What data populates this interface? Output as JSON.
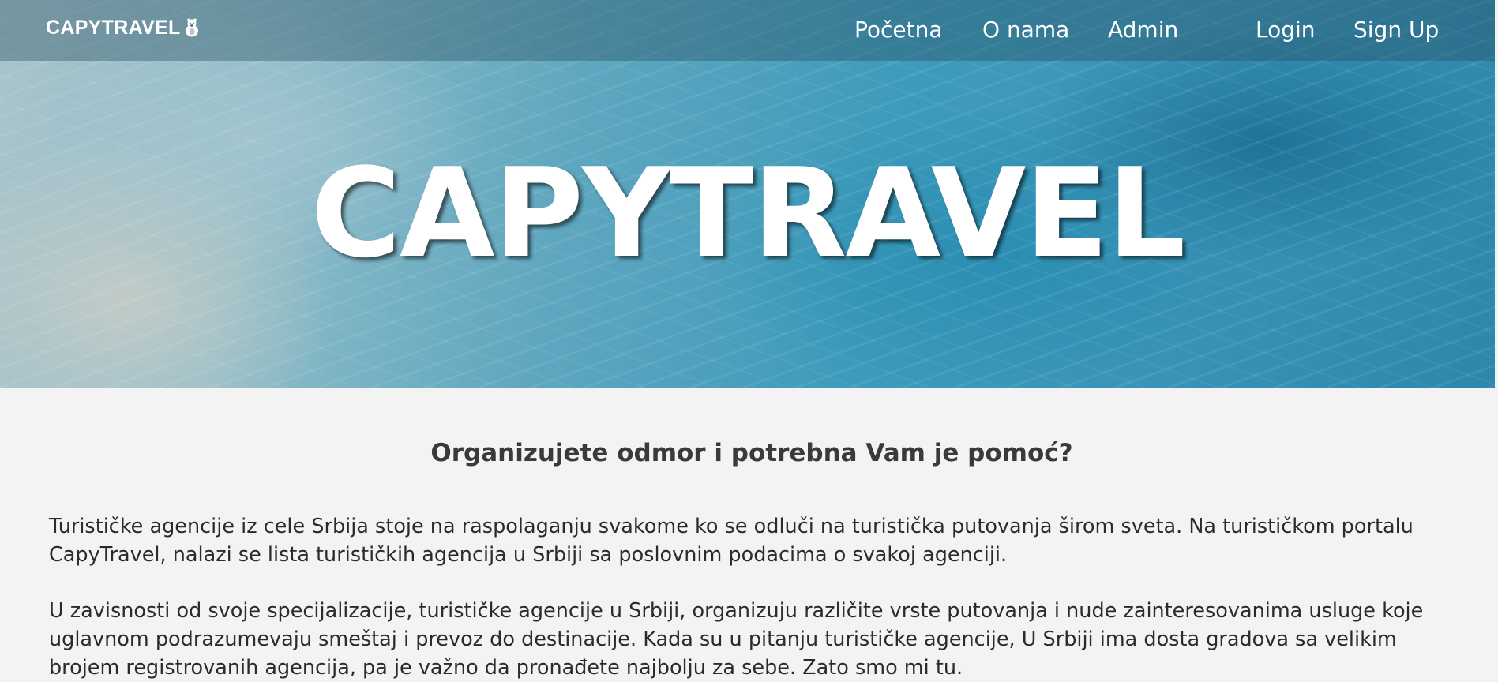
{
  "navbar": {
    "brand": "CAPYTRAVEL",
    "brand_icon": "capybara-icon",
    "links": {
      "home": "Početna",
      "about": "O nama",
      "admin": "Admin",
      "login": "Login",
      "signup": "Sign Up"
    }
  },
  "hero": {
    "title": "CAPYTRAVEL"
  },
  "main": {
    "heading": "Organizujete odmor i potrebna Vam je pomoć?",
    "paragraphs": [
      "Turističke agencije iz cele Srbija stoje na raspolaganju svakome ko se odluči na turistička putovanja širom sveta. Na turističkom portalu CapyTravel, nalazi se lista turističkih agencija u Srbiji sa poslovnim podacima o svakoj agenciji.",
      "U zavisnosti od svoje specijalizacije, turističke agencije u Srbiji, organizuju različite vrste putovanja i nude zainteresovanima usluge koje uglavnom podrazumevaju smeštaj i prevoz do destinacije. Kada su u pitanju turističke agencije, U Srbiji ima dosta gradova sa velikim brojem registrovanih agencija, pa je važno da pronađete najbolju za sebe. Zato smo mi tu."
    ]
  },
  "colors": {
    "page_background": "#f3f3f3",
    "hero_water": "#3f9bbb",
    "nav_text": "#ffffff",
    "body_text": "#2b2b2b"
  }
}
